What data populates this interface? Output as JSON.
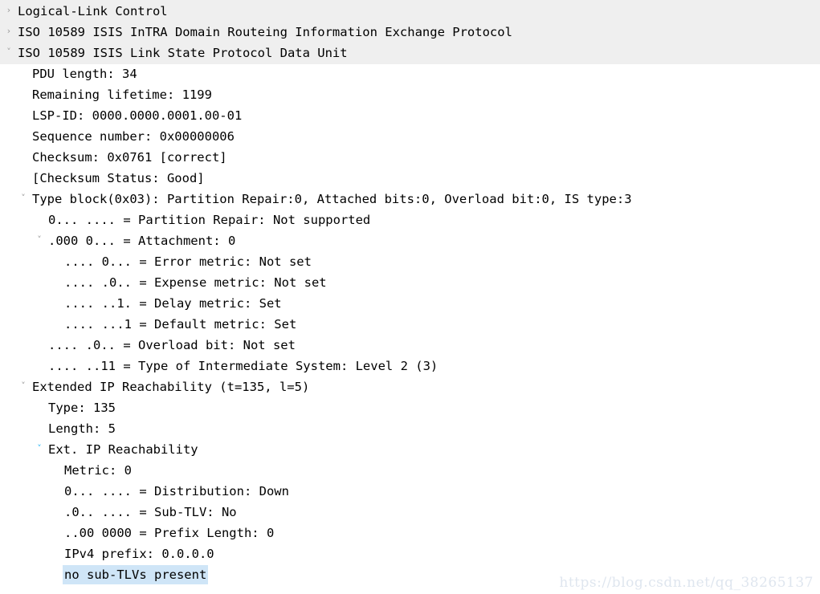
{
  "window": {
    "title": "Wireshark packet details pane",
    "background": "#ffffff",
    "header_band_color": "#efefef",
    "selection_color": "#cfe5f7",
    "twisty_color": "#9a9a9a",
    "twisty_accent_color": "#29b6f6"
  },
  "icons": {
    "collapsed": "›",
    "expanded": "˅"
  },
  "watermark": {
    "text": "https://blog.csdn.net/qq_38265137"
  },
  "tree": {
    "rows": [
      {
        "indent": 0,
        "twisty": "collapsed",
        "accent": false,
        "selected": false,
        "banded": true,
        "text": "Logical-Link Control"
      },
      {
        "indent": 0,
        "twisty": "collapsed",
        "accent": false,
        "selected": false,
        "banded": true,
        "text": "ISO 10589 ISIS InTRA Domain Routeing Information Exchange Protocol"
      },
      {
        "indent": 0,
        "twisty": "expanded",
        "accent": false,
        "selected": false,
        "banded": true,
        "text": "ISO 10589 ISIS Link State Protocol Data Unit"
      },
      {
        "indent": 1,
        "twisty": "none",
        "accent": false,
        "selected": false,
        "banded": false,
        "text": "PDU length: 34"
      },
      {
        "indent": 1,
        "twisty": "none",
        "accent": false,
        "selected": false,
        "banded": false,
        "text": "Remaining lifetime: 1199"
      },
      {
        "indent": 1,
        "twisty": "none",
        "accent": false,
        "selected": false,
        "banded": false,
        "text": "LSP-ID: 0000.0000.0001.00-01"
      },
      {
        "indent": 1,
        "twisty": "none",
        "accent": false,
        "selected": false,
        "banded": false,
        "text": "Sequence number: 0x00000006"
      },
      {
        "indent": 1,
        "twisty": "none",
        "accent": false,
        "selected": false,
        "banded": false,
        "text": "Checksum: 0x0761 [correct]"
      },
      {
        "indent": 1,
        "twisty": "none",
        "accent": false,
        "selected": false,
        "banded": false,
        "text": "[Checksum Status: Good]"
      },
      {
        "indent": 1,
        "twisty": "expanded",
        "accent": false,
        "selected": false,
        "banded": false,
        "text": "Type block(0x03): Partition Repair:0, Attached bits:0, Overload bit:0, IS type:3"
      },
      {
        "indent": 2,
        "twisty": "none",
        "accent": false,
        "selected": false,
        "banded": false,
        "text": "0... .... = Partition Repair: Not supported"
      },
      {
        "indent": 2,
        "twisty": "expanded",
        "accent": false,
        "selected": false,
        "banded": false,
        "text": ".000 0... = Attachment: 0"
      },
      {
        "indent": 3,
        "twisty": "none",
        "accent": false,
        "selected": false,
        "banded": false,
        "text": ".... 0... = Error metric: Not set"
      },
      {
        "indent": 3,
        "twisty": "none",
        "accent": false,
        "selected": false,
        "banded": false,
        "text": ".... .0.. = Expense metric: Not set"
      },
      {
        "indent": 3,
        "twisty": "none",
        "accent": false,
        "selected": false,
        "banded": false,
        "text": ".... ..1. = Delay metric: Set"
      },
      {
        "indent": 3,
        "twisty": "none",
        "accent": false,
        "selected": false,
        "banded": false,
        "text": ".... ...1 = Default metric: Set"
      },
      {
        "indent": 2,
        "twisty": "none",
        "accent": false,
        "selected": false,
        "banded": false,
        "text": ".... .0.. = Overload bit: Not set"
      },
      {
        "indent": 2,
        "twisty": "none",
        "accent": false,
        "selected": false,
        "banded": false,
        "text": ".... ..11 = Type of Intermediate System: Level 2 (3)"
      },
      {
        "indent": 1,
        "twisty": "expanded",
        "accent": false,
        "selected": false,
        "banded": false,
        "text": "Extended IP Reachability (t=135, l=5)"
      },
      {
        "indent": 2,
        "twisty": "none",
        "accent": false,
        "selected": false,
        "banded": false,
        "text": "Type: 135"
      },
      {
        "indent": 2,
        "twisty": "none",
        "accent": false,
        "selected": false,
        "banded": false,
        "text": "Length: 5"
      },
      {
        "indent": 2,
        "twisty": "expanded",
        "accent": true,
        "selected": false,
        "banded": false,
        "text": "Ext. IP Reachability"
      },
      {
        "indent": 3,
        "twisty": "none",
        "accent": false,
        "selected": false,
        "banded": false,
        "text": "Metric: 0"
      },
      {
        "indent": 3,
        "twisty": "none",
        "accent": false,
        "selected": false,
        "banded": false,
        "text": "0... .... = Distribution: Down"
      },
      {
        "indent": 3,
        "twisty": "none",
        "accent": false,
        "selected": false,
        "banded": false,
        "text": ".0.. .... = Sub-TLV: No"
      },
      {
        "indent": 3,
        "twisty": "none",
        "accent": false,
        "selected": false,
        "banded": false,
        "text": "..00 0000 = Prefix Length: 0"
      },
      {
        "indent": 3,
        "twisty": "none",
        "accent": false,
        "selected": false,
        "banded": false,
        "text": "IPv4 prefix: 0.0.0.0"
      },
      {
        "indent": 3,
        "twisty": "none",
        "accent": false,
        "selected": true,
        "banded": false,
        "text": "no sub-TLVs present"
      }
    ]
  }
}
